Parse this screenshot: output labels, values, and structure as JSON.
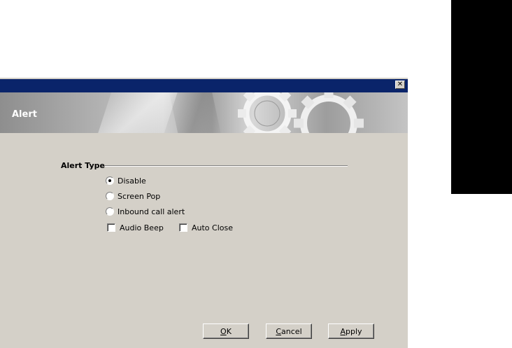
{
  "dialog": {
    "close_glyph": "✕",
    "banner_title": "Alert"
  },
  "alert_type": {
    "group_label": "Alert Type",
    "options": [
      {
        "label": "Disable",
        "selected": true
      },
      {
        "label": "Screen Pop",
        "selected": false
      },
      {
        "label": "Inbound call alert",
        "selected": false
      }
    ],
    "checkboxes": [
      {
        "label": "Audio Beep",
        "checked": false
      },
      {
        "label": "Auto Close",
        "checked": false
      }
    ]
  },
  "buttons": {
    "ok": {
      "mnemonic": "O",
      "rest": "K"
    },
    "cancel": {
      "mnemonic": "C",
      "rest": "ancel"
    },
    "apply": {
      "mnemonic": "A",
      "rest": "pply"
    }
  },
  "colors": {
    "titlebar": "#0a246a",
    "dialog_bg": "#d4d0c8"
  }
}
